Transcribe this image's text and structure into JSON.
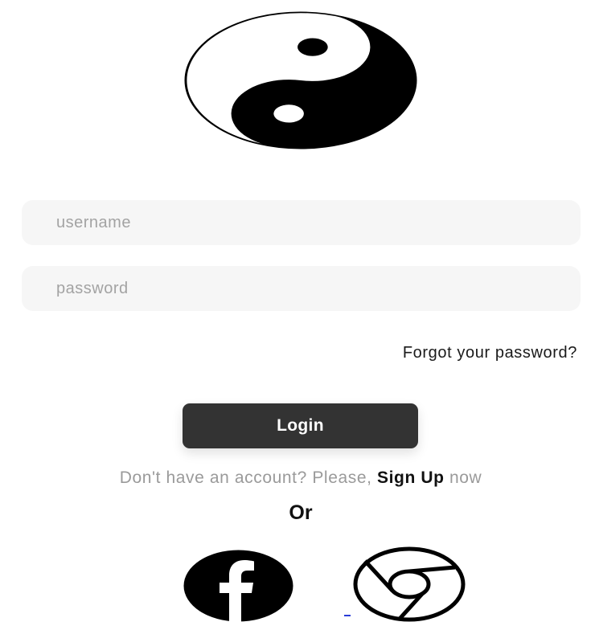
{
  "logo": {
    "icon": "yin-yang-icon"
  },
  "form": {
    "username_placeholder": "username",
    "password_placeholder": "password",
    "forgot_label": "Forgot your password?",
    "login_label": "Login"
  },
  "signup": {
    "prefix": "Don't have an account? Please, ",
    "link_label": "Sign Up",
    "suffix": " now"
  },
  "divider": {
    "or_label": "Or"
  },
  "social": [
    {
      "name": "facebook",
      "icon": "facebook-icon"
    },
    {
      "name": "chrome",
      "icon": "chrome-icon"
    }
  ],
  "colors": {
    "input_bg": "#f6f6f6",
    "button_bg": "#333333",
    "muted_text": "#9a9a9a"
  }
}
